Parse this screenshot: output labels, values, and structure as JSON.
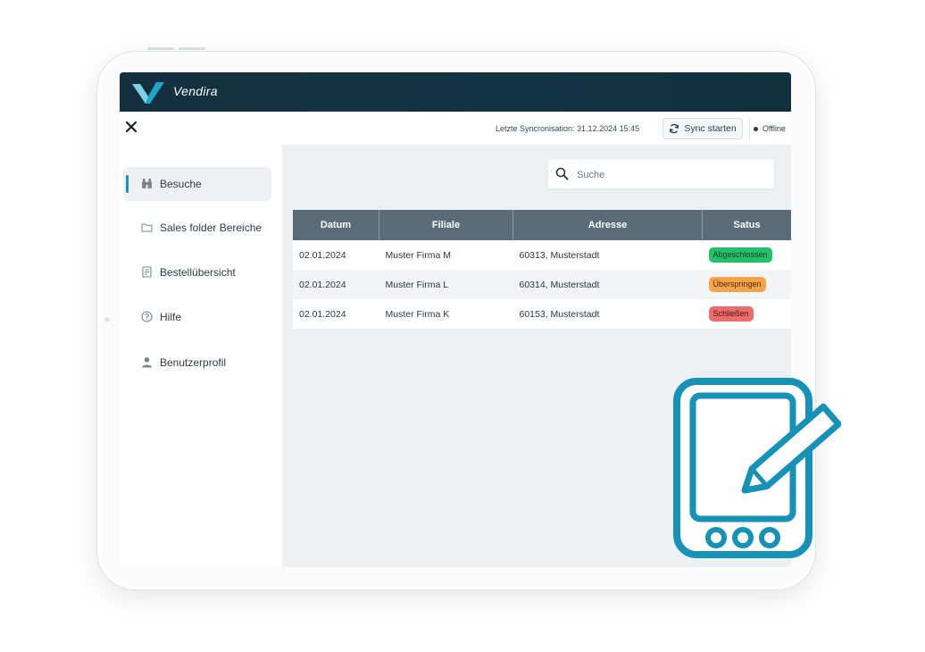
{
  "app": {
    "brand": "Vendira"
  },
  "topbar": {
    "sync_info": "Letzte Syncronisation: 31.12.2024   15:45",
    "sync_button": "Sync starten",
    "status": "Offline"
  },
  "sidebar": {
    "items": [
      {
        "label": "Besuche",
        "icon": "binoculars-icon",
        "active": true
      },
      {
        "label": "Sales folder Bereiche",
        "icon": "folder-icon",
        "active": false
      },
      {
        "label": "Bestellübersicht",
        "icon": "book-icon",
        "active": false
      },
      {
        "label": "Hilfe",
        "icon": "help-icon",
        "active": false
      },
      {
        "label": "Benutzerprofil",
        "icon": "user-icon",
        "active": false
      }
    ]
  },
  "search": {
    "placeholder": "Suche"
  },
  "table": {
    "headers": [
      "Datum",
      "Filiale",
      "Adresse",
      "Satus"
    ],
    "rows": [
      {
        "datum": "02.01.2024",
        "filiale": "Muster Firma M",
        "adresse": "60313, Musterstadt",
        "status": "Abgeschlossen"
      },
      {
        "datum": "02.01.2024",
        "filiale": "Muster Firma L",
        "adresse": "60314, Musterstadt",
        "status": "Überspringen"
      },
      {
        "datum": "02.01.2024",
        "filiale": "Muster Firma K",
        "adresse": "60153, Musterstadt",
        "status": "Schließen"
      }
    ]
  },
  "colors": {
    "header_bg": "#14303f",
    "accent": "#1794b6",
    "table_header": "#5a6c78",
    "status_done": "#22c06a",
    "status_skip": "#f5a44a",
    "status_close": "#ec6b6b",
    "tablet_icon": "#1592b8"
  }
}
